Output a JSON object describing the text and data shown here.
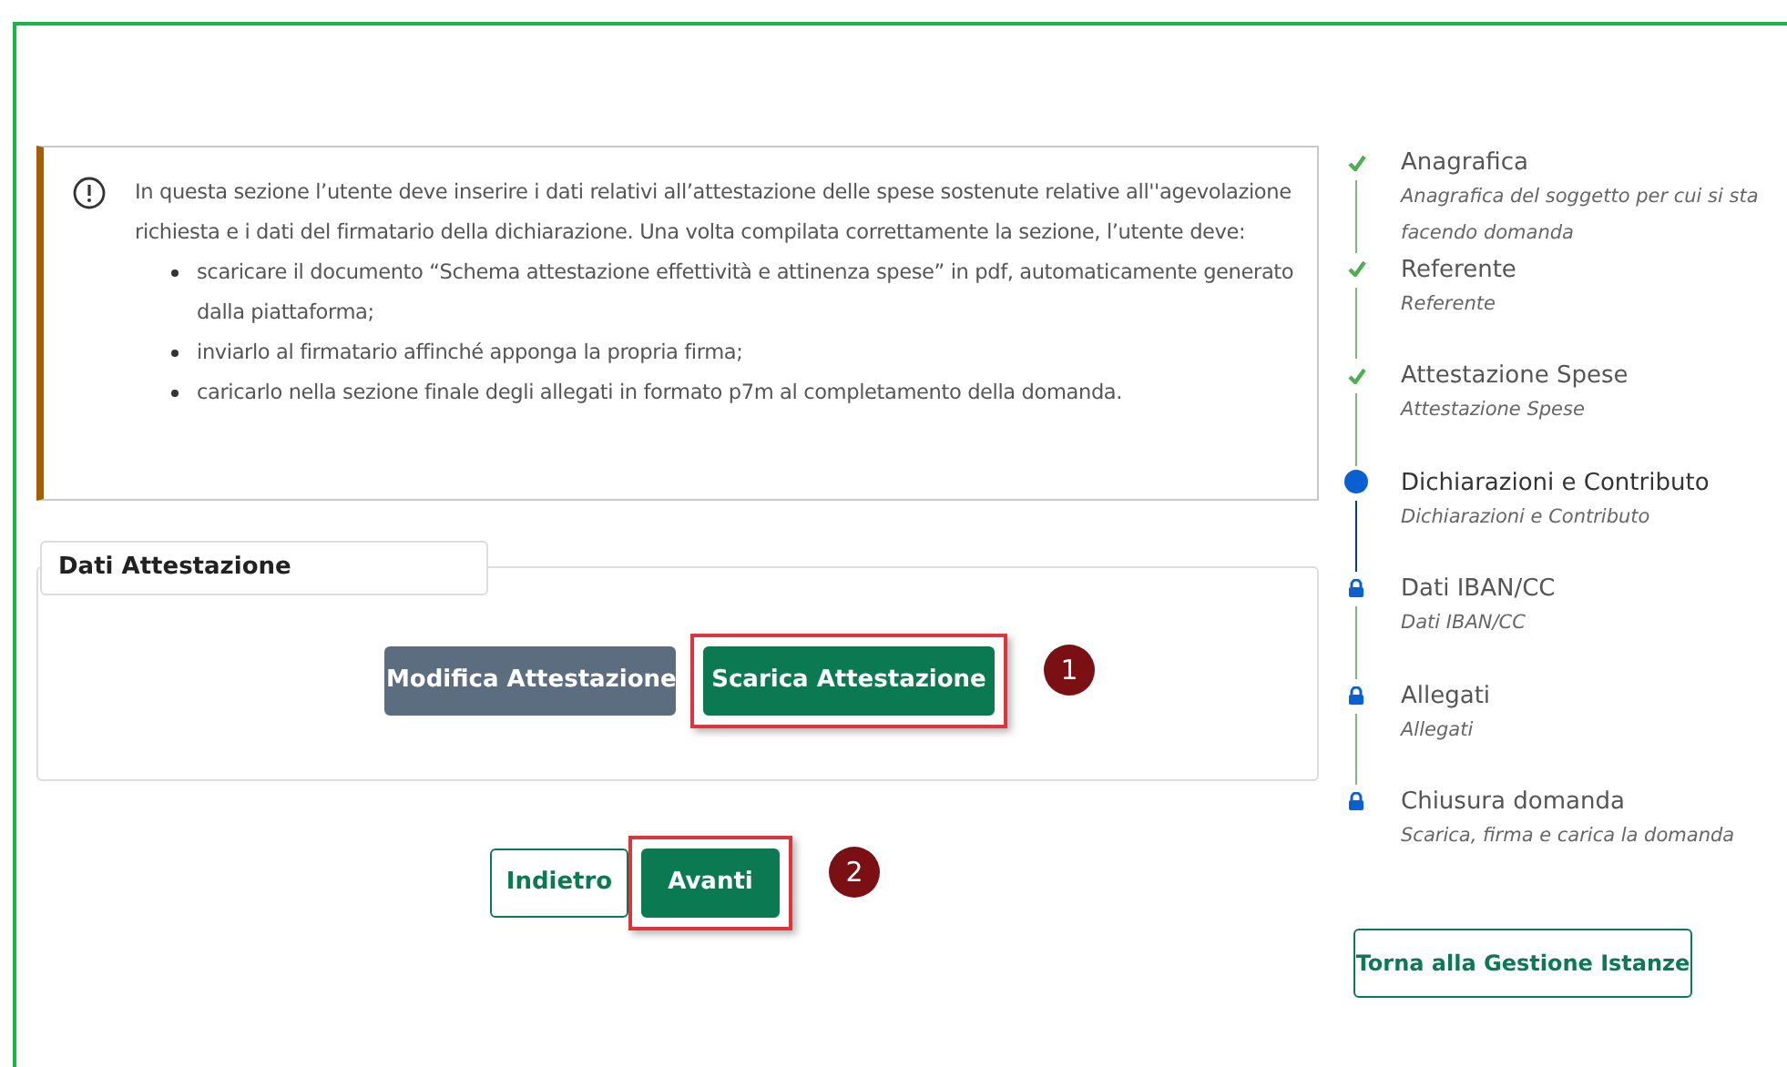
{
  "notice": {
    "intro": "In questa sezione l’utente deve inserire i dati relativi all’attestazione delle spese sostenute relative all''agevolazione richiesta e i dati del firmatario della dichiarazione. Una volta compilata correttamente la sezione, l’utente deve:",
    "items": [
      "scaricare il documento “Schema attestazione effettività e attinenza spese” in pdf, automaticamente generato dalla piattaforma;",
      "inviarlo al firmatario affinché apponga la propria firma;",
      "caricarlo nella sezione finale degli allegati in formato p7m al completamento della domanda."
    ]
  },
  "section": {
    "title": "Dati Attestazione",
    "buttons": [
      {
        "label": "Modifica Attestazione",
        "kind": "secondary"
      },
      {
        "label": "Scarica Attestazione",
        "kind": "primary",
        "callout": "1"
      }
    ]
  },
  "navigation": [
    {
      "label": "Indietro",
      "kind": "outline"
    },
    {
      "label": "Avanti",
      "kind": "primary",
      "callout": "2"
    }
  ],
  "steps": [
    {
      "title": "Anagrafica",
      "subtitle": "Anagrafica del soggetto per cui si sta facendo domanda",
      "kind": "done"
    },
    {
      "title": "Referente",
      "subtitle": "Referente",
      "kind": "done"
    },
    {
      "title": "Attestazione Spese",
      "subtitle": "Attestazione Spese",
      "kind": "done"
    },
    {
      "title": "Dichiarazioni e Contributo",
      "subtitle": "Dichiarazioni e Contributo",
      "kind": "current"
    },
    {
      "title": "Dati IBAN/CC",
      "subtitle": "Dati IBAN/CC",
      "kind": "locked"
    },
    {
      "title": "Allegati",
      "subtitle": "Allegati",
      "kind": "locked"
    },
    {
      "title": "Chiusura domanda",
      "subtitle": "Scarica, firma e carica la domanda",
      "kind": "locked"
    }
  ],
  "back_button": "Torna alla Gestione Istanze"
}
